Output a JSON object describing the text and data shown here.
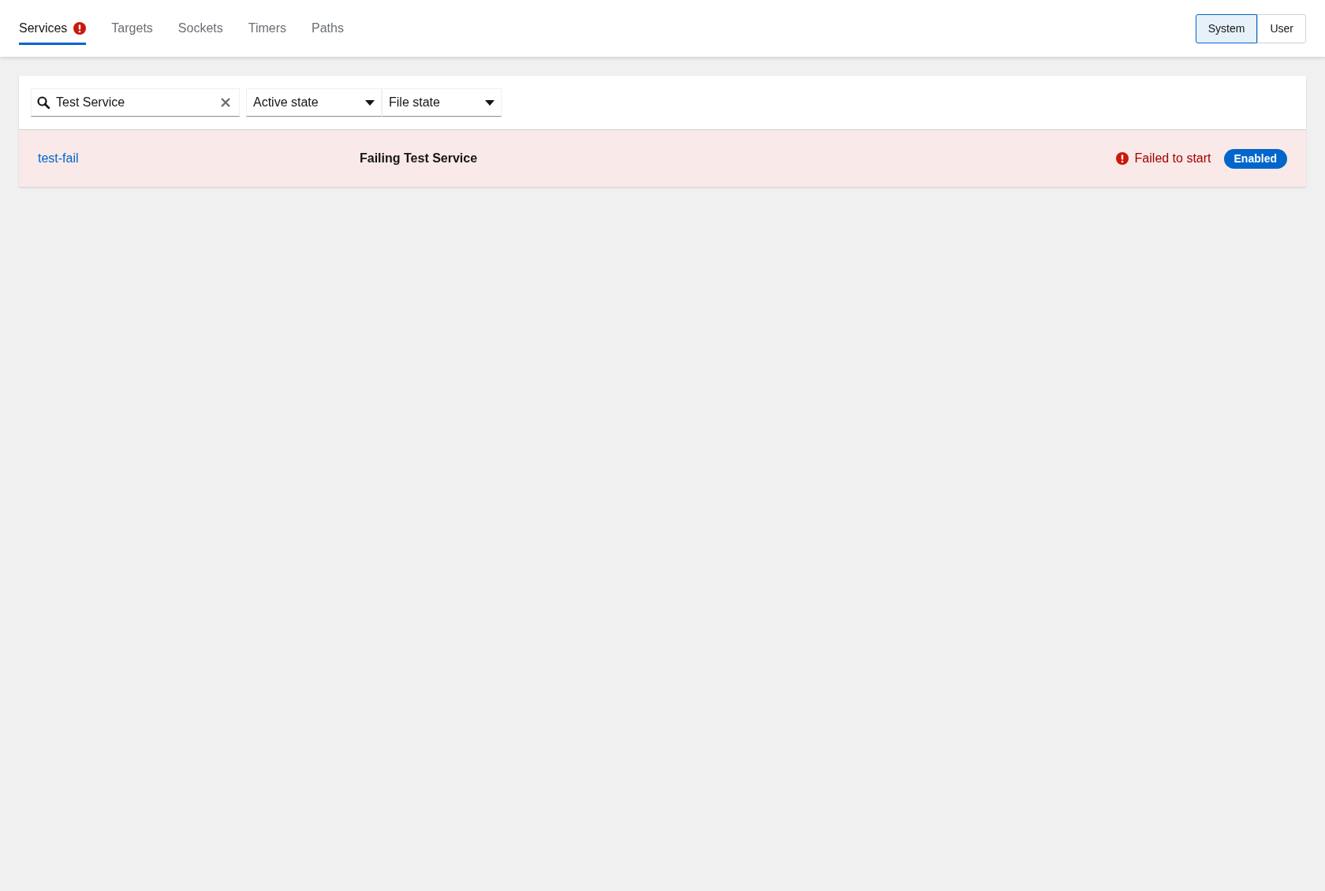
{
  "tabs": [
    {
      "label": "Services",
      "selected": true,
      "alert": true
    },
    {
      "label": "Targets",
      "selected": false,
      "alert": false
    },
    {
      "label": "Sockets",
      "selected": false,
      "alert": false
    },
    {
      "label": "Timers",
      "selected": false,
      "alert": false
    },
    {
      "label": "Paths",
      "selected": false,
      "alert": false
    }
  ],
  "scope": [
    {
      "label": "System",
      "selected": true
    },
    {
      "label": "User",
      "selected": false
    }
  ],
  "toolbar": {
    "search": {
      "value": "Test Service"
    },
    "filters": [
      {
        "label": "Active state"
      },
      {
        "label": "File state"
      }
    ]
  },
  "units": [
    {
      "name": "test-fail",
      "description": "Failing Test Service",
      "failed": true,
      "status": "Failed to start",
      "file_state": "Enabled"
    }
  ]
}
